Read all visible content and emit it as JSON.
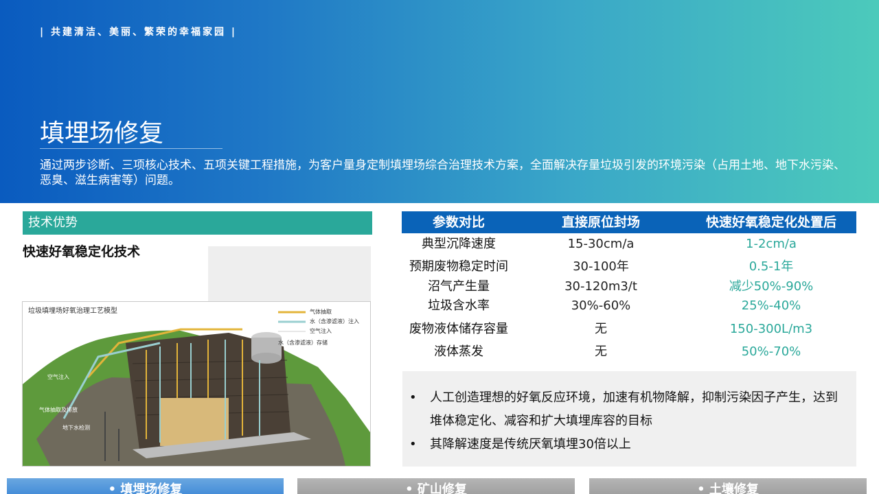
{
  "header": {
    "slogan": "| 共建清洁、美丽、繁荣的幸福家园 |",
    "title": "填埋场修复",
    "intro": "通过两步诊断、三项核心技术、五项关键工程措施，为客户量身定制填埋场综合治理技术方案，全面解决存量垃圾引发的环境污染（占用土地、地下水污染、恶臭、滋生病害等）问题。"
  },
  "advantage": {
    "bar_label": "技术优势",
    "tech_heading": "快速好氧稳定化技术"
  },
  "diagram": {
    "title": "垃圾填埋场好氧治理工艺模型",
    "legend": [
      "气体抽取",
      "水（含渗滤液）注入",
      "空气注入",
      "水（含渗滤液）存储"
    ],
    "labels": [
      "空气注入",
      "气体抽取及排放",
      "地下水检测"
    ]
  },
  "table": {
    "headers": [
      "参数对比",
      "直接原位封场",
      "快速好氧稳定化处置后"
    ],
    "rows": [
      [
        "典型沉降速度",
        "15-30cm/a",
        "1-2cm/a"
      ],
      [
        "预期废物稳定时间",
        "30-100年",
        "0.5-1年"
      ],
      [
        "沼气产生量",
        "30-120m3/t",
        "减少50%-90%"
      ],
      [
        "垃圾含水率",
        "30%-60%",
        "25%-40%"
      ],
      [
        "废物液体储存容量",
        "无",
        "150-300L/m3"
      ],
      [
        "液体蒸发",
        "无",
        "50%-70%"
      ]
    ]
  },
  "bullets": [
    "人工创造理想的好氧反应环境，加速有机物降解，抑制污染因子产生，达到堆体稳定化、减容和扩大填埋库容的目标",
    "其降解速度是传统厌氧填埋30倍以上"
  ],
  "bullet_symbol": "•",
  "tabs": [
    "• 填埋场修复",
    "• 矿山修复",
    "• 土壤修复"
  ],
  "colors": {
    "accent_green": "#2aa89a",
    "table_blue": "#0a63b8"
  }
}
